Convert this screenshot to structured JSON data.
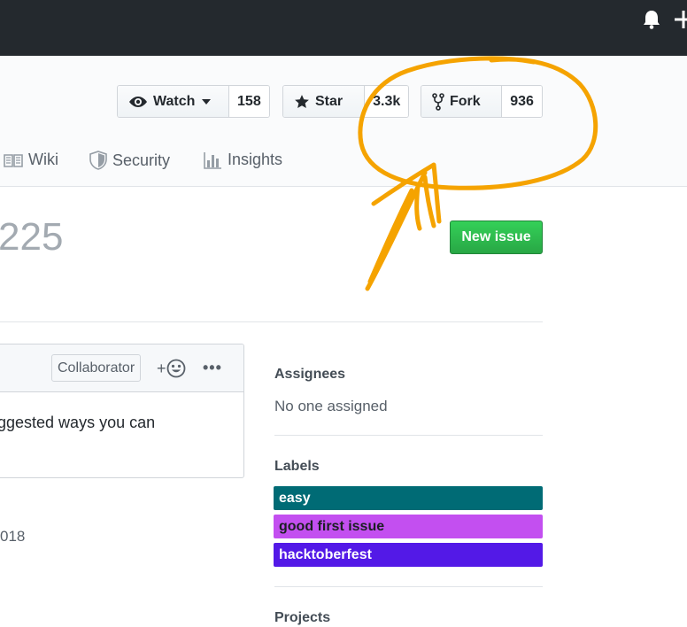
{
  "header": {
    "icons": [
      "bell-icon",
      "plus-icon"
    ]
  },
  "repo_actions": {
    "watch": {
      "label": "Watch",
      "count": "158"
    },
    "star": {
      "label": "Star",
      "count": "3.3k"
    },
    "fork": {
      "label": "Fork",
      "count": "936"
    }
  },
  "tabs": [
    {
      "label": "Wiki",
      "icon": "book-icon"
    },
    {
      "label": "Security",
      "icon": "shield-icon"
    },
    {
      "label": "Insights",
      "icon": "graph-icon"
    }
  ],
  "issue": {
    "number_fragment": "225",
    "new_issue_label": "New issue"
  },
  "comment": {
    "role_badge": "Collaborator",
    "react_label": "+",
    "more_label": "•••",
    "body_fragment": "ggested ways you can"
  },
  "date_fragment": "018",
  "sidebar": {
    "assignees_heading": "Assignees",
    "assignees_value": "No one assigned",
    "labels_heading": "Labels",
    "labels": [
      {
        "name": "easy",
        "color": "#006b75",
        "text_color": "#ffffff"
      },
      {
        "name": "good first issue",
        "color": "#c34ff0",
        "text_color": "#1b1f23"
      },
      {
        "name": "hacktoberfest",
        "color": "#5319e7",
        "text_color": "#ffffff"
      }
    ],
    "projects_heading": "Projects"
  },
  "colors": {
    "accent_green": "#28a745",
    "annotation_orange": "#f5a300",
    "topbar": "#24292e"
  }
}
